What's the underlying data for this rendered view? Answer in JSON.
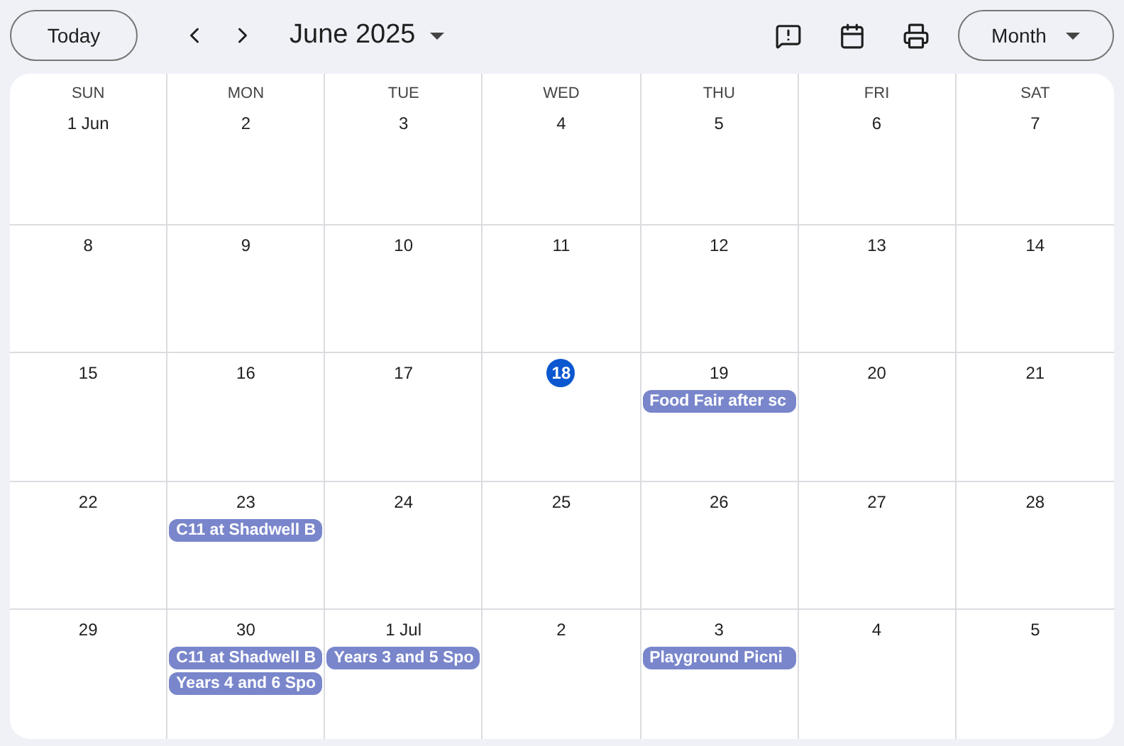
{
  "toolbar": {
    "today_button": "Today",
    "month_title": "June 2025",
    "view_button": "Month"
  },
  "weekdays": [
    "SUN",
    "MON",
    "TUE",
    "WED",
    "THU",
    "FRI",
    "SAT"
  ],
  "weeks": [
    [
      {
        "date": "1 Jun",
        "today": false
      },
      {
        "date": "2",
        "today": false
      },
      {
        "date": "3",
        "today": false
      },
      {
        "date": "4",
        "today": false
      },
      {
        "date": "5",
        "today": false
      },
      {
        "date": "6",
        "today": false
      },
      {
        "date": "7",
        "today": false
      }
    ],
    [
      {
        "date": "8",
        "today": false
      },
      {
        "date": "9",
        "today": false
      },
      {
        "date": "10",
        "today": false
      },
      {
        "date": "11",
        "today": false
      },
      {
        "date": "12",
        "today": false
      },
      {
        "date": "13",
        "today": false
      },
      {
        "date": "14",
        "today": false
      }
    ],
    [
      {
        "date": "15",
        "today": false
      },
      {
        "date": "16",
        "today": false
      },
      {
        "date": "17",
        "today": false
      },
      {
        "date": "18",
        "today": true
      },
      {
        "date": "19",
        "today": false,
        "events": [
          "Food Fair after sc"
        ]
      },
      {
        "date": "20",
        "today": false
      },
      {
        "date": "21",
        "today": false
      }
    ],
    [
      {
        "date": "22",
        "today": false
      },
      {
        "date": "23",
        "today": false,
        "events": [
          "C11 at Shadwell B"
        ]
      },
      {
        "date": "24",
        "today": false
      },
      {
        "date": "25",
        "today": false
      },
      {
        "date": "26",
        "today": false
      },
      {
        "date": "27",
        "today": false
      },
      {
        "date": "28",
        "today": false
      }
    ],
    [
      {
        "date": "29",
        "today": false
      },
      {
        "date": "30",
        "today": false,
        "events": [
          "C11 at Shadwell B",
          "Years 4 and 6 Spo"
        ]
      },
      {
        "date": "1 Jul",
        "today": false,
        "events": [
          "Years 3 and 5 Spo"
        ]
      },
      {
        "date": "2",
        "today": false
      },
      {
        "date": "3",
        "today": false,
        "events": [
          "Playground Picni"
        ]
      },
      {
        "date": "4",
        "today": false
      },
      {
        "date": "5",
        "today": false
      }
    ]
  ]
}
